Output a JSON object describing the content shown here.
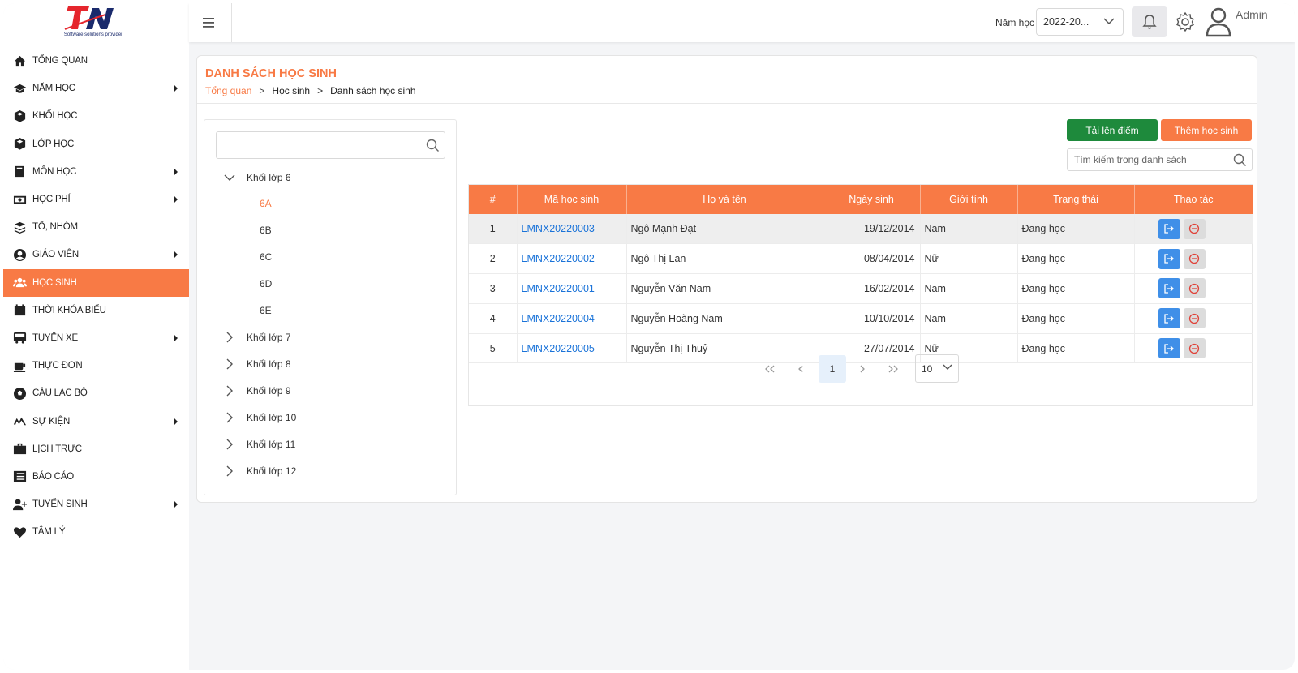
{
  "brand": {
    "logo_text": "TN",
    "tagline": "Software solutions provider",
    "primary": "#f87a45",
    "logo_red": "#e5262d",
    "logo_blue": "#1a2a6c"
  },
  "sidebar": {
    "items": [
      {
        "label": "TỔNG QUAN",
        "icon": "home-icon",
        "has_submenu": false,
        "active": false
      },
      {
        "label": "NĂM HỌC",
        "icon": "graduation-cap-icon",
        "has_submenu": true,
        "active": false
      },
      {
        "label": "KHỐI HỌC",
        "icon": "cube-icon",
        "has_submenu": false,
        "active": false
      },
      {
        "label": "LỚP HỌC",
        "icon": "cube-icon",
        "has_submenu": false,
        "active": false
      },
      {
        "label": "MÔN HỌC",
        "icon": "book-icon",
        "has_submenu": true,
        "active": false
      },
      {
        "label": "HỌC PHÍ",
        "icon": "money-icon",
        "has_submenu": true,
        "active": false
      },
      {
        "label": "TỔ, NHÓM",
        "icon": "layers-icon",
        "has_submenu": false,
        "active": false
      },
      {
        "label": "GIÁO VIÊN",
        "icon": "user-circle-icon",
        "has_submenu": true,
        "active": false
      },
      {
        "label": "HỌC SINH",
        "icon": "users-icon",
        "has_submenu": false,
        "active": true
      },
      {
        "label": "THỜI KHÓA BIỂU",
        "icon": "calendar-icon",
        "has_submenu": false,
        "active": false
      },
      {
        "label": "TUYẾN XE",
        "icon": "bus-icon",
        "has_submenu": true,
        "active": false
      },
      {
        "label": "THỰC ĐƠN",
        "icon": "coffee-icon",
        "has_submenu": false,
        "active": false
      },
      {
        "label": "CÂU LẠC BỘ",
        "icon": "ball-icon",
        "has_submenu": false,
        "active": false
      },
      {
        "label": "SỰ KIỆN",
        "icon": "event-icon",
        "has_submenu": true,
        "active": false
      },
      {
        "label": "LỊCH TRỰC",
        "icon": "briefcase-icon",
        "has_submenu": false,
        "active": false
      },
      {
        "label": "BÁO CÁO",
        "icon": "list-icon",
        "has_submenu": false,
        "active": false
      },
      {
        "label": "TUYỂN SINH",
        "icon": "user-plus-icon",
        "has_submenu": true,
        "active": false
      },
      {
        "label": "TÂM LÝ",
        "icon": "heart-pulse-icon",
        "has_submenu": false,
        "active": false
      }
    ]
  },
  "header": {
    "year_label": "Năm học",
    "year_value": "2022-20...",
    "user_name": "Admin"
  },
  "page": {
    "title": "DANH SÁCH HỌC SINH",
    "breadcrumb": [
      "Tổng quan",
      "Học sinh",
      "Danh sách học sinh"
    ],
    "breadcrumb_sep": ">"
  },
  "tree": {
    "search_placeholder": "",
    "expanded": {
      "label": "Khối lớp 6",
      "children": [
        "6A",
        "6B",
        "6C",
        "6D",
        "6E"
      ],
      "selected": "6A"
    },
    "collapsed": [
      "Khối lớp 7",
      "Khối lớp 8",
      "Khối lớp 9",
      "Khối lớp 10",
      "Khối lớp 11",
      "Khối lớp 12"
    ]
  },
  "actions": {
    "upload_label": "Tải lên điểm",
    "add_label": "Thêm học sinh",
    "search_placeholder": "Tìm kiếm trong danh sách"
  },
  "table": {
    "columns": [
      "#",
      "Mã học sinh",
      "Họ và tên",
      "Ngày sinh",
      "Giới tính",
      "Trạng thái",
      "Thao tác"
    ],
    "rows": [
      {
        "no": "1",
        "code": "LMNX20220003",
        "name": "Ngô Mạnh Đạt",
        "dob": "19/12/2014",
        "gender": "Nam",
        "status": "Đang học"
      },
      {
        "no": "2",
        "code": "LMNX20220002",
        "name": "Ngô Thị Lan",
        "dob": "08/04/2014",
        "gender": "Nữ",
        "status": "Đang học"
      },
      {
        "no": "3",
        "code": "LMNX20220001",
        "name": "Nguyễn Văn Nam",
        "dob": "16/02/2014",
        "gender": "Nam",
        "status": "Đang học"
      },
      {
        "no": "4",
        "code": "LMNX20220004",
        "name": "Nguyễn Hoàng Nam",
        "dob": "10/10/2014",
        "gender": "Nam",
        "status": "Đang học"
      },
      {
        "no": "5",
        "code": "LMNX20220005",
        "name": "Nguyễn Thị Thuỷ",
        "dob": "27/07/2014",
        "gender": "Nữ",
        "status": "Đang học"
      }
    ]
  },
  "pagination": {
    "current_page": "1",
    "page_size": "10"
  }
}
